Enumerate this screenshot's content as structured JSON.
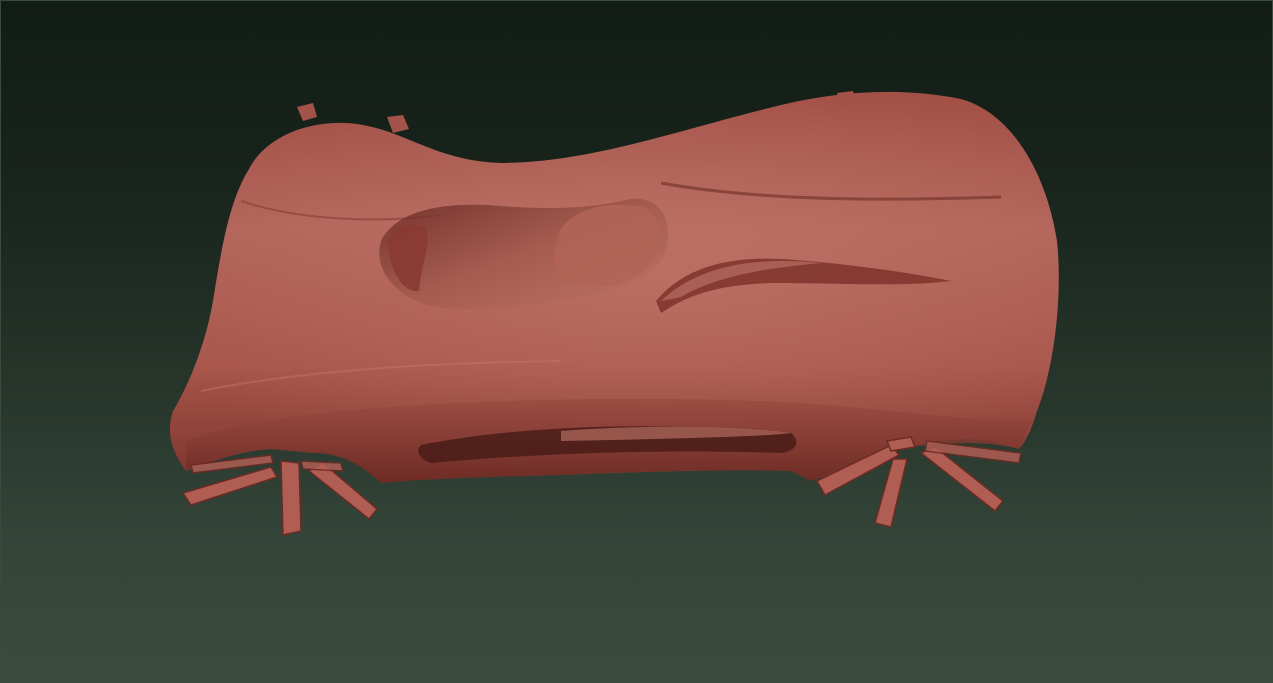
{
  "viewport": {
    "background_top": "#111c14",
    "background_bottom": "#3a4b3f",
    "border_color": "#3a4a3f"
  },
  "model": {
    "subject": "car-body-sculpt-mesh",
    "material_color": "#a9554b",
    "highlight_color": "#c87a6c",
    "shadow_color": "#5a2520"
  }
}
